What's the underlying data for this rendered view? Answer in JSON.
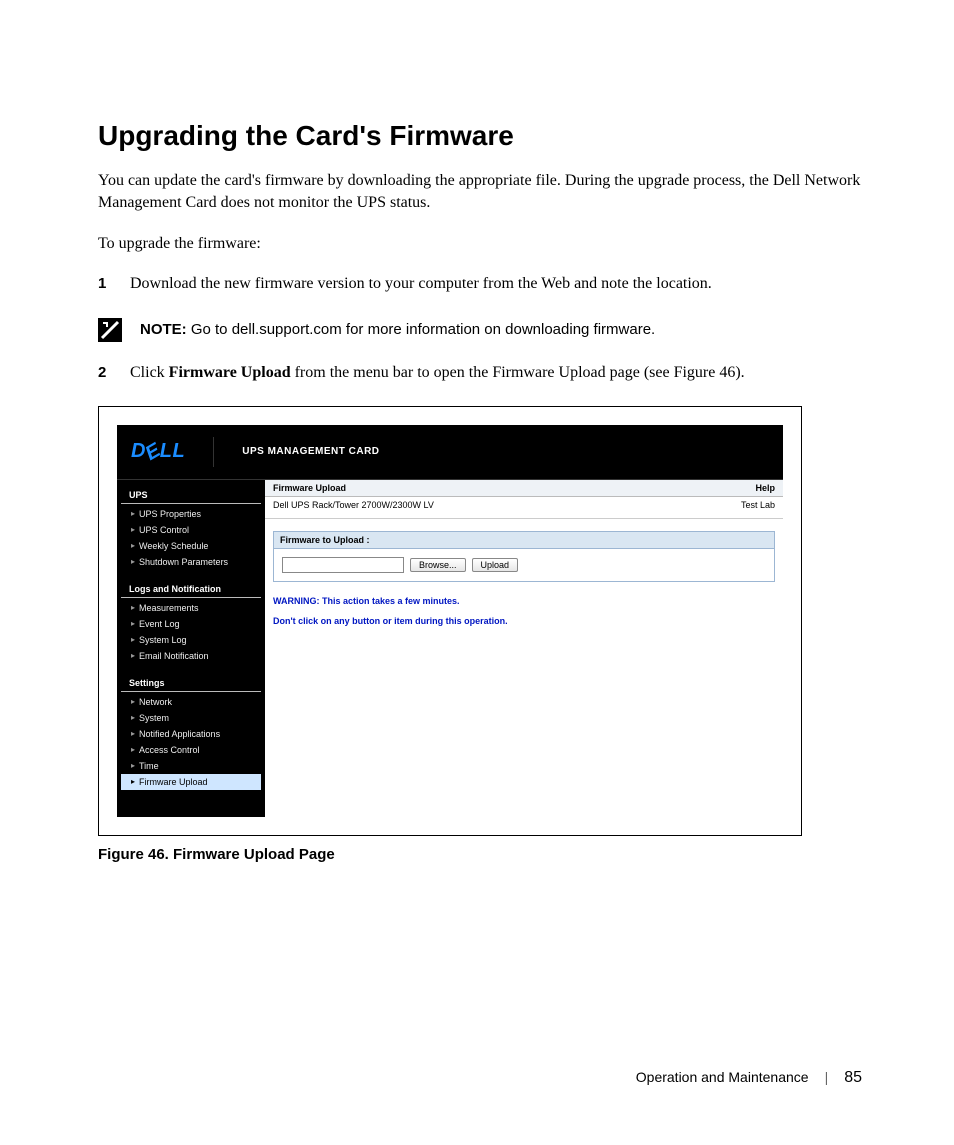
{
  "heading": "Upgrading the Card's Firmware",
  "intro": "You can update the card's firmware by downloading the appropriate file. During the upgrade process, the Dell Network Management Card does not monitor the UPS status.",
  "lead": "To upgrade the firmware:",
  "steps": {
    "s1_num": "1",
    "s1_text": "Download the new firmware version to your computer from the Web and note the location.",
    "s2_num": "2",
    "s2_pre": "Click ",
    "s2_bold": "Firmware Upload",
    "s2_post": " from the menu bar to open the Firmware Upload page (see Figure 46)."
  },
  "note": {
    "label": "NOTE:",
    "text": " Go to dell.support.com for more information on downloading firmware."
  },
  "app": {
    "logo": "DELL",
    "title": "UPS MANAGEMENT CARD",
    "sidebar": {
      "section1_title": "UPS",
      "section1": [
        "UPS Properties",
        "UPS Control",
        "Weekly Schedule",
        "Shutdown Parameters"
      ],
      "section2_title": "Logs and Notification",
      "section2": [
        "Measurements",
        "Event Log",
        "System Log",
        "Email Notification"
      ],
      "section3_title": "Settings",
      "section3": [
        "Network",
        "System",
        "Notified Applications",
        "Access Control",
        "Time",
        "Firmware Upload"
      ]
    },
    "main": {
      "title": "Firmware Upload",
      "help": "Help",
      "device": "Dell UPS Rack/Tower 2700W/2300W LV",
      "location": "Test Lab",
      "panel_header": "Firmware to Upload :",
      "browse": "Browse...",
      "upload": "Upload",
      "warn1": "WARNING: This action takes a few minutes.",
      "warn2": "Don't click on any button or item during this operation."
    }
  },
  "figure_caption": "Figure 46. Firmware Upload Page",
  "footer": {
    "section": "Operation and Maintenance",
    "page": "85"
  }
}
